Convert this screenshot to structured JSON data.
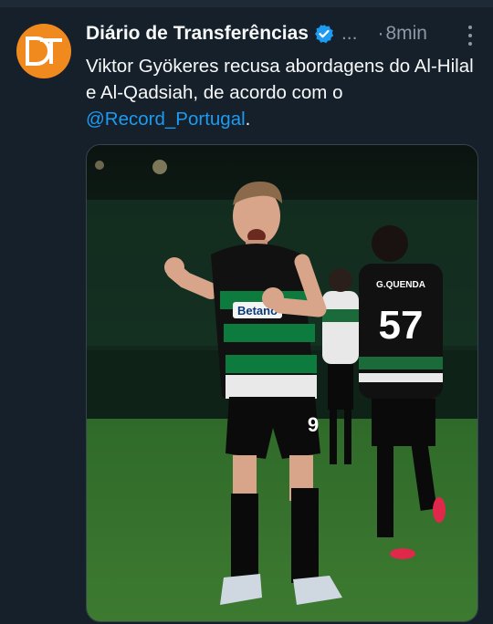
{
  "tweet": {
    "author_name": "Diário de Transferências",
    "ellipsis": "...",
    "separator": "·",
    "time": "8min",
    "text_before": "Viktor Gyökeres recusa abordagens do Al-Hilal e Al-Qadsiah, de acordo com o ",
    "mention": "@Record_Portugal",
    "text_after": ".",
    "avatar_initials": "DT"
  },
  "photo": {
    "player_front_number": "9",
    "player_back_number": "57",
    "player_back_name": "G.QUENDA",
    "sponsor": "Betano"
  },
  "colors": {
    "background": "#15202b",
    "avatar_orange": "#f08a1f",
    "link_blue": "#1d9bf0",
    "muted": "#8b98a5",
    "jersey_green": "#0d7a3e"
  }
}
